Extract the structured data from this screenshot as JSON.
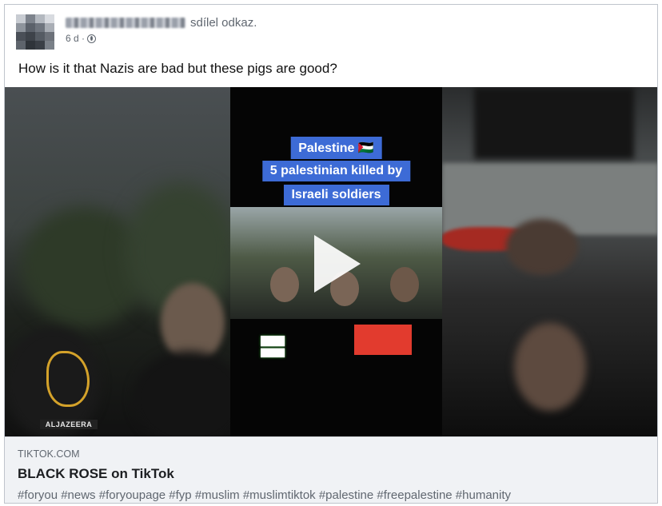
{
  "post": {
    "action_text": "sdílel odkaz.",
    "time": "6 d ·",
    "text": "How is it that Nazis are bad but these pigs are good?",
    "privacy_icon": "globe-icon"
  },
  "video": {
    "caption_line1": "Palestine 🇵🇸",
    "caption_line2": "5 palestinian killed by",
    "caption_line3": "Israeli soldiers",
    "watermark_logo": "ALJAZEERA",
    "play_icon": "play-icon"
  },
  "link": {
    "domain": "TIKTOK.COM",
    "title": "BLACK ROSE on TikTok",
    "description": "#foryou #news #foryoupage #fyp #muslim #muslimtiktok #palestine #freepalestine #humanity"
  },
  "colors": {
    "caption_bg": "#3d6bd6",
    "link_bg": "#f0f2f5",
    "red_overlay": "#e23b2e"
  }
}
